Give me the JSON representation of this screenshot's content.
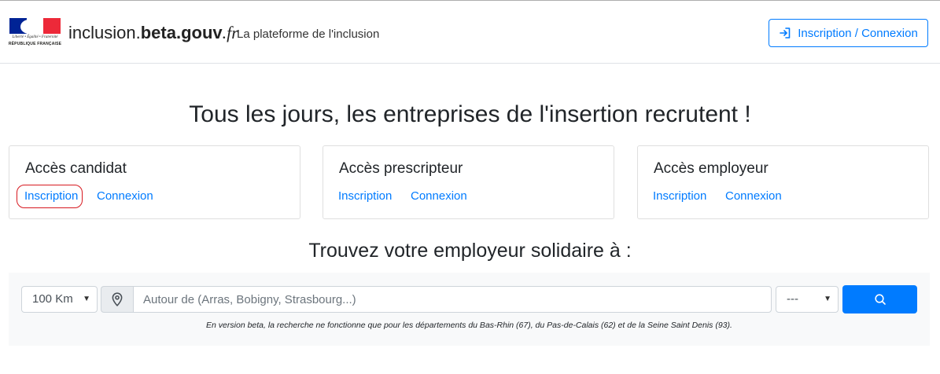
{
  "header": {
    "logo": {
      "motto": "Liberté • Égalité • Fraternité",
      "republic": "RÉPUBLIQUE FRANÇAISE"
    },
    "brand": {
      "part1": "inclusion.",
      "part2": "beta",
      "part3": ".gouv",
      "part4": ".fr"
    },
    "tagline": "La plateforme de l'inclusion",
    "login_button": {
      "label": "Inscription / Connexion",
      "icon": "sign-in-icon"
    }
  },
  "main": {
    "title": "Tous les jours, les entreprises de l'insertion recrutent !",
    "cards": [
      {
        "title": "Accès candidat",
        "signup": "Inscription",
        "login": "Connexion"
      },
      {
        "title": "Accès prescripteur",
        "signup": "Inscription",
        "login": "Connexion"
      },
      {
        "title": "Accès employeur",
        "signup": "Inscription",
        "login": "Connexion"
      }
    ],
    "search_title": "Trouvez votre employeur solidaire à :"
  },
  "search": {
    "distance": "100 Km",
    "city_placeholder": "Autour de (Arras, Bobigny, Strasbourg...)",
    "city_value": "",
    "department": "---",
    "note": "En version beta, la recherche ne fonctionne que pour les départements du Bas-Rhin (67), du Pas-de-Calais (62) et de la Seine Saint Denis (93)."
  },
  "colors": {
    "accent": "#007bff",
    "annotation": "#d71920",
    "flag_blue": "#002395",
    "flag_red": "#ed2939"
  }
}
